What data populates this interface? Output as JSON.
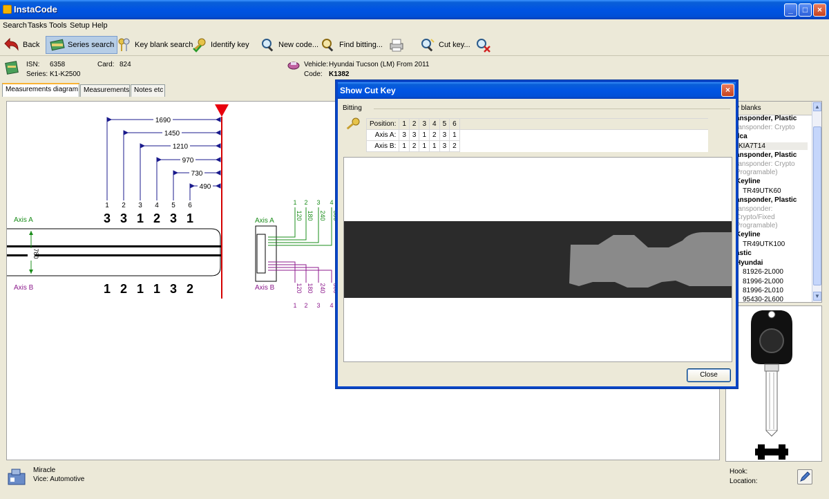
{
  "window": {
    "title": "InstaCode"
  },
  "menu": [
    "Search",
    "Tasks",
    "Tools",
    "Setup",
    "Help"
  ],
  "toolbar": {
    "back": "Back",
    "series_search": "Series search",
    "key_blank_search": "Key blank search",
    "identify_key": "Identify key",
    "new_code": "New code...",
    "find_bitting": "Find bitting...",
    "cut_key": "Cut key..."
  },
  "info": {
    "isn_label": "ISN:",
    "isn_value": "6358",
    "card_label": "Card:",
    "card_value": "824",
    "series_label": "Series:",
    "series_value": "K1-K2500",
    "vehicle_label": "Vehicle:",
    "vehicle_value": "Hyundai Tucson (LM) From 2011",
    "code_label": "Code:",
    "code_value": "K1382"
  },
  "tabs": [
    "Measurements diagram",
    "Measurements",
    "Notes etc"
  ],
  "diagram": {
    "dimensions": [
      "1690",
      "1450",
      "1210",
      "970",
      "730",
      "490"
    ],
    "positions": [
      "1",
      "2",
      "3",
      "4",
      "5",
      "6"
    ],
    "axis_a_label": "Axis A",
    "axis_b_label": "Axis B",
    "axis_a_cuts": [
      "3",
      "3",
      "1",
      "2",
      "3",
      "1"
    ],
    "axis_b_cuts": [
      "1",
      "2",
      "1",
      "1",
      "3",
      "2"
    ],
    "width_dim": "780",
    "depth_positions": [
      "1",
      "2",
      "3",
      "4"
    ],
    "depth_values": [
      "120",
      "180",
      "240",
      "300"
    ]
  },
  "status": {
    "machine": "Miracle",
    "vice": "Vice: Automotive"
  },
  "right_panel": {
    "header": "y blanks",
    "items": [
      {
        "text": "ansponder, Plastic",
        "style": "bold"
      },
      {
        "text": "ransponder: Crypto",
        "style": "grey"
      },
      {
        "text": "ilca",
        "style": "bold"
      },
      {
        "text": "KIA7T14",
        "style": "sel"
      },
      {
        "text": "ansponder, Plastic",
        "style": "bold"
      },
      {
        "text": "ransponder: Crypto",
        "style": "grey"
      },
      {
        "text": "Programable)",
        "style": "grey"
      },
      {
        "text": "Keyline",
        "style": "bold"
      },
      {
        "text": "TR49UTK60",
        "style": "sub"
      },
      {
        "text": "ansponder, Plastic",
        "style": "bold"
      },
      {
        "text": "ransponder:",
        "style": "grey"
      },
      {
        "text": "Crypto/Fixed",
        "style": "grey"
      },
      {
        "text": "Programable)",
        "style": "grey"
      },
      {
        "text": "Keyline",
        "style": "bold"
      },
      {
        "text": "TR49UTK100",
        "style": "sub"
      },
      {
        "text": "astic",
        "style": "bold"
      },
      {
        "text": "Hyundai",
        "style": "bold"
      },
      {
        "text": "81926-2L000",
        "style": "sub"
      },
      {
        "text": "81996-2L000",
        "style": "sub"
      },
      {
        "text": "81996-2L010",
        "style": "sub"
      },
      {
        "text": "95430-2L600",
        "style": "sub"
      }
    ]
  },
  "bottom_right": {
    "hook": "Hook:",
    "location": "Location:"
  },
  "dialog": {
    "title": "Show Cut Key",
    "group": "Bitting",
    "position_label": "Position:",
    "positions": [
      "1",
      "2",
      "3",
      "4",
      "5",
      "6"
    ],
    "axis_a_label": "Axis A:",
    "axis_a": [
      "3",
      "3",
      "1",
      "2",
      "3",
      "1"
    ],
    "axis_b_label": "Axis B:",
    "axis_b": [
      "1",
      "2",
      "1",
      "1",
      "3",
      "2"
    ],
    "close": "Close"
  }
}
